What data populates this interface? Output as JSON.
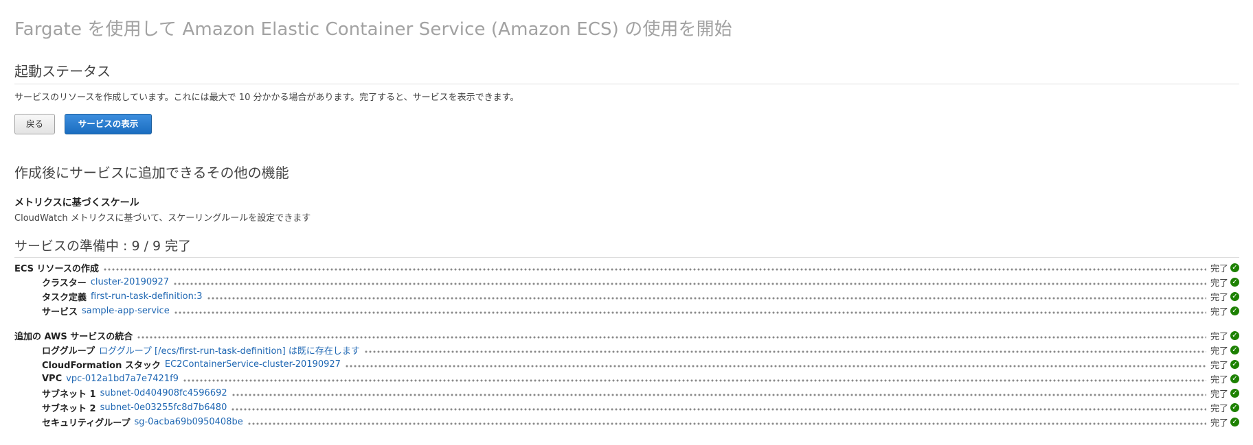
{
  "page": {
    "title": "Fargate を使用して Amazon Elastic Container Service (Amazon ECS) の使用を開始"
  },
  "launch_status": {
    "heading": "起動ステータス",
    "description": "サービスのリソースを作成しています。これには最大で 10 分かかる場合があります。完了すると、サービスを表示できます。",
    "back_label": "戻る",
    "view_service_label": "サービスの表示"
  },
  "additional_features": {
    "heading": "作成後にサービスに追加できるその他の機能",
    "feature_title": "メトリクスに基づくスケール",
    "feature_desc": "CloudWatch メトリクスに基づいて、スケーリングルールを設定できます"
  },
  "preparing": {
    "heading": "サービスの準備中 : 9 / 9 完了",
    "status_label": "完了",
    "ok_icon": "check-circle-icon",
    "ok_color": "#1d8102",
    "link_color": "#1f67b3",
    "groups": [
      {
        "label": "ECS リソースの作成",
        "items": [
          {
            "label": "クラスター",
            "value": "cluster-20190927"
          },
          {
            "label": "タスク定義",
            "value": "first-run-task-definition:3"
          },
          {
            "label": "サービス",
            "value": "sample-app-service"
          }
        ]
      },
      {
        "label": "追加の AWS サービスの統合",
        "items": [
          {
            "label": "ロググループ",
            "value": "ロググループ [/ecs/first-run-task-definition] は既に存在します"
          },
          {
            "label": "CloudFormation スタック",
            "value": "EC2ContainerService-cluster-20190927"
          },
          {
            "label": "VPC",
            "value": "vpc-012a1bd7a7e7421f9"
          },
          {
            "label": "サブネット 1",
            "value": "subnet-0d404908fc4596692"
          },
          {
            "label": "サブネット 2",
            "value": "subnet-0e03255fc8d7b6480"
          },
          {
            "label": "セキュリティグループ",
            "value": "sg-0acba69b0950408be"
          }
        ]
      }
    ]
  }
}
